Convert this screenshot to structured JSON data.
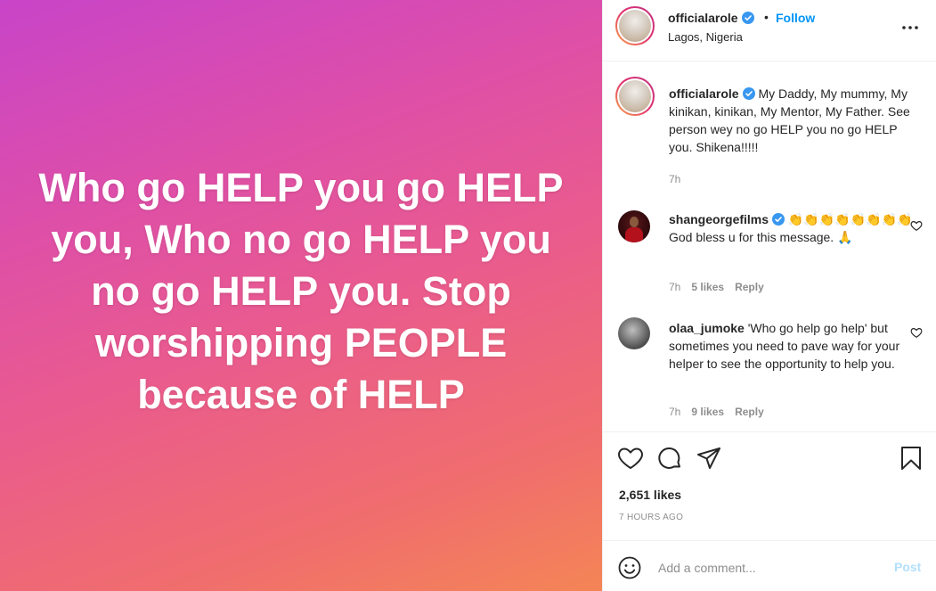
{
  "post": {
    "text": "Who go HELP you go HELP you, Who no go HELP you no go HELP you. Stop worshipping PEOPLE because of HELP"
  },
  "header": {
    "username": "officialarole",
    "dot": "•",
    "follow_label": "Follow",
    "location": "Lagos, Nigeria"
  },
  "caption": {
    "username": "officialarole",
    "text": "My Daddy, My mummy, My kinikan, kinikan, My Mentor, My Father. See person wey no go HELP you no go HELP you. Shikena!!!!!",
    "time": "7h"
  },
  "comments": [
    {
      "username": "shangeorgefilms",
      "text": "👏👏👏👏👏👏👏👏 God bless u for this message. 🙏",
      "time": "7h",
      "likes": "5 likes",
      "reply": "Reply"
    },
    {
      "username": "olaa_jumoke",
      "text": "'Who go help go help' but sometimes you need to pave way for your helper to see the opportunity to help you.",
      "time": "7h",
      "likes": "9 likes",
      "reply": "Reply"
    }
  ],
  "stats": {
    "likes": "2,651 likes",
    "time_ago": "7 HOURS AGO"
  },
  "add_comment": {
    "placeholder": "Add a comment...",
    "post_label": "Post"
  },
  "colors": {
    "accent": "#0095f6",
    "verified": "#3897f0",
    "post_disabled": "#b2dffc",
    "gradient_start": "#c844c8",
    "gradient_end": "#f48556"
  },
  "icons": [
    "verified-icon",
    "more-icon",
    "heart-icon",
    "comment-icon",
    "share-icon",
    "bookmark-icon",
    "emoji-icon"
  ]
}
